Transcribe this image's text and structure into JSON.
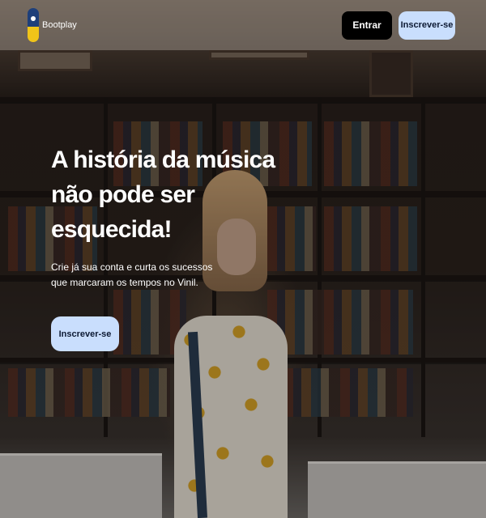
{
  "header": {
    "brand_name": "Bootplay",
    "login_label": "Entrar",
    "signup_label": "Inscrever-se"
  },
  "hero": {
    "title": "A história da música não pode ser esquecida!",
    "subtitle": "Crie já sua conta e curta os sucessos que marcaram os tempos no Vinil.",
    "cta_label": "Inscrever-se"
  },
  "icons": {
    "logo": "bootplay-logo-icon"
  },
  "colors": {
    "accent_button": "#c9defd",
    "login_button": "#000000",
    "logo_blue": "#1e3f7a",
    "logo_yellow": "#f0c419"
  }
}
